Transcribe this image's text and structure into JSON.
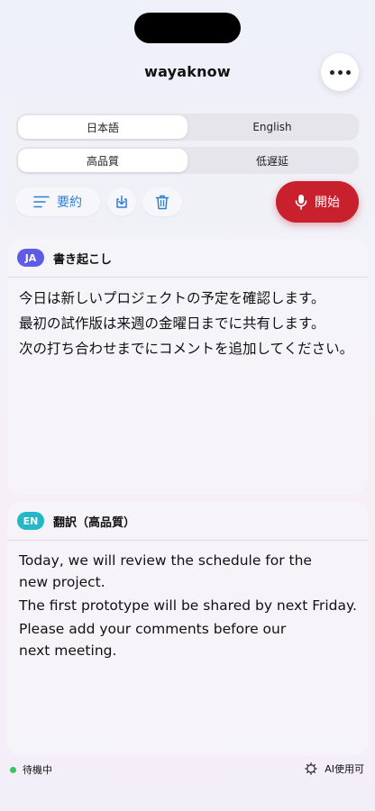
{
  "app": {
    "title": "wayaknow"
  },
  "language_toggle": {
    "options": [
      "日本語",
      "English"
    ],
    "selected": "日本語"
  },
  "quality_toggle": {
    "options": [
      "高品質",
      "低遅延"
    ],
    "selected": "高品質"
  },
  "toolbar": {
    "summary_label": "要約",
    "download_icon": "download-icon",
    "delete_icon": "trash-icon",
    "start_label": "開始",
    "start_color": "#c8202c"
  },
  "transcript": {
    "badge": "JA",
    "title": "書き起こし",
    "lines": [
      "今日は新しいプロジェクトの予定を確認します。",
      "最初の試作版は来週の金曜日までに共有します。",
      "次の打ち合わせまでにコメントを追加してください。"
    ]
  },
  "translation": {
    "badge": "EN",
    "title": "翻訳（高品質）",
    "lines": [
      [
        "Today, we will review the schedule for the",
        "new project."
      ],
      [
        "The first prototype will be shared by next Friday."
      ],
      [
        "Please add your comments before our",
        "next meeting."
      ]
    ]
  },
  "status": {
    "state": "待機中",
    "ai": "AI使用可"
  },
  "colors": {
    "accent": "#2f7fd3",
    "ja_badge": "#5e5ce6",
    "en_badge": "#23b7c8",
    "status_ok": "#34c759"
  }
}
